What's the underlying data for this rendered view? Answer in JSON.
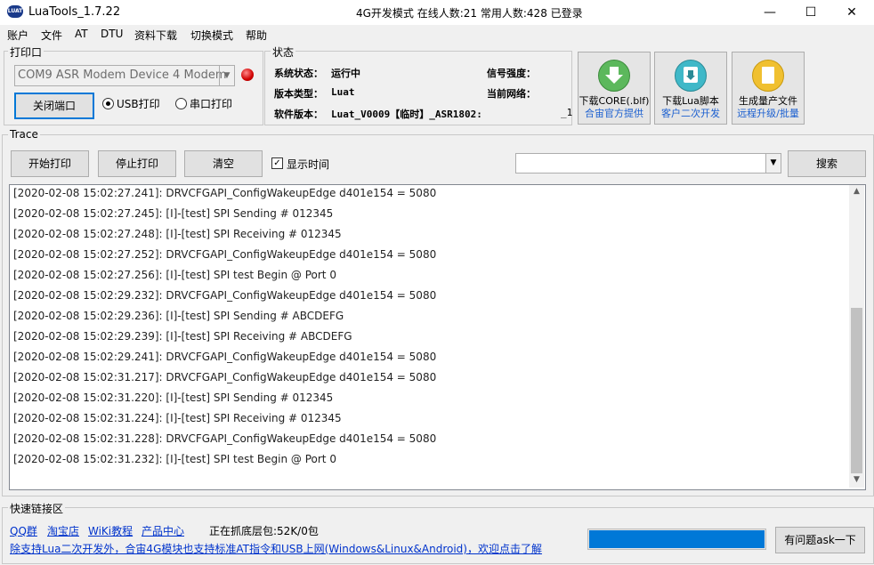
{
  "window": {
    "title": "LuaTools_1.7.22",
    "center_title": "4G开发模式  在线人数:21 常用人数:428 已登录",
    "minimize": "—",
    "maximize": "☐",
    "close": "✕"
  },
  "menu": [
    "账户",
    "文件",
    "AT",
    "DTU",
    "资料下载",
    "切换模式",
    "帮助"
  ],
  "print_port": {
    "title": "打印口",
    "selected_port": "COM9 ASR Modem Device 4 Modem",
    "close_port_label": "关闭端口",
    "usb_print_label": "USB打印",
    "serial_print_label": "串口打印",
    "usb_selected": true
  },
  "status": {
    "title": "状态",
    "system_status_label": "系统状态：",
    "system_status_value": "运行中",
    "version_type_label": "版本类型：",
    "version_type_value": "Luat",
    "software_version_label": "软件版本：",
    "software_version_value": "Luat_V0009【临时】_ASR1802:",
    "software_version_tail": "_1",
    "signal_label": "信号强度：",
    "network_label": "当前网络："
  },
  "action_buttons": [
    {
      "title": "下载CORE(.blf)",
      "subtitle": "合宙官方提供",
      "icon_color": "#5cb85c"
    },
    {
      "title": "下载Lua脚本",
      "subtitle": "客户二次开发",
      "icon_color": "#3fb8c8"
    },
    {
      "title": "生成量产文件",
      "subtitle": "远程升级/批量",
      "icon_color": "#f0c030"
    }
  ],
  "trace": {
    "title": "Trace",
    "start_print_label": "开始打印",
    "stop_print_label": "停止打印",
    "clear_label": "清空",
    "show_time_label": "显示时间",
    "show_time_checked": true,
    "search_label": "搜索",
    "search_value": ""
  },
  "log_lines": [
    "[2020-02-08 15:02:27.241]: DRVCFGAPI_ConfigWakeupEdge d401e154 = 5080",
    "[2020-02-08 15:02:27.245]: [I]-[test] SPI Sending # 012345",
    "[2020-02-08 15:02:27.248]: [I]-[test] SPI Receiving # 012345",
    "[2020-02-08 15:02:27.252]: DRVCFGAPI_ConfigWakeupEdge d401e154 = 5080",
    "[2020-02-08 15:02:27.256]: [I]-[test] SPI test Begin @ Port 0",
    "[2020-02-08 15:02:29.232]: DRVCFGAPI_ConfigWakeupEdge d401e154 = 5080",
    "[2020-02-08 15:02:29.236]: [I]-[test] SPI Sending # ABCDEFG",
    "[2020-02-08 15:02:29.239]: [I]-[test] SPI Receiving # ABCDEFG",
    "[2020-02-08 15:02:29.241]: DRVCFGAPI_ConfigWakeupEdge d401e154 = 5080",
    "[2020-02-08 15:02:31.217]: DRVCFGAPI_ConfigWakeupEdge d401e154 = 5080",
    "[2020-02-08 15:02:31.220]: [I]-[test] SPI Sending # 012345",
    "[2020-02-08 15:02:31.224]: [I]-[test] SPI Receiving # 012345",
    "[2020-02-08 15:02:31.228]: DRVCFGAPI_ConfigWakeupEdge d401e154 = 5080",
    "[2020-02-08 15:02:31.232]: [I]-[test] SPI test Begin @ Port 0"
  ],
  "quick_links": {
    "title": "快速链接区",
    "links": [
      "QQ群",
      "淘宝店",
      "WiKi教程",
      "产品中心"
    ],
    "capture_status": "正在抓底层包:52K/0包",
    "promo_link": "除支持Lua二次开发外，合宙4G模块也支持标准AT指令和USB上网(Windows&Linux&Android)，欢迎点击了解",
    "ask_button": "有问题ask一下",
    "progress_color": "#0078d7"
  }
}
